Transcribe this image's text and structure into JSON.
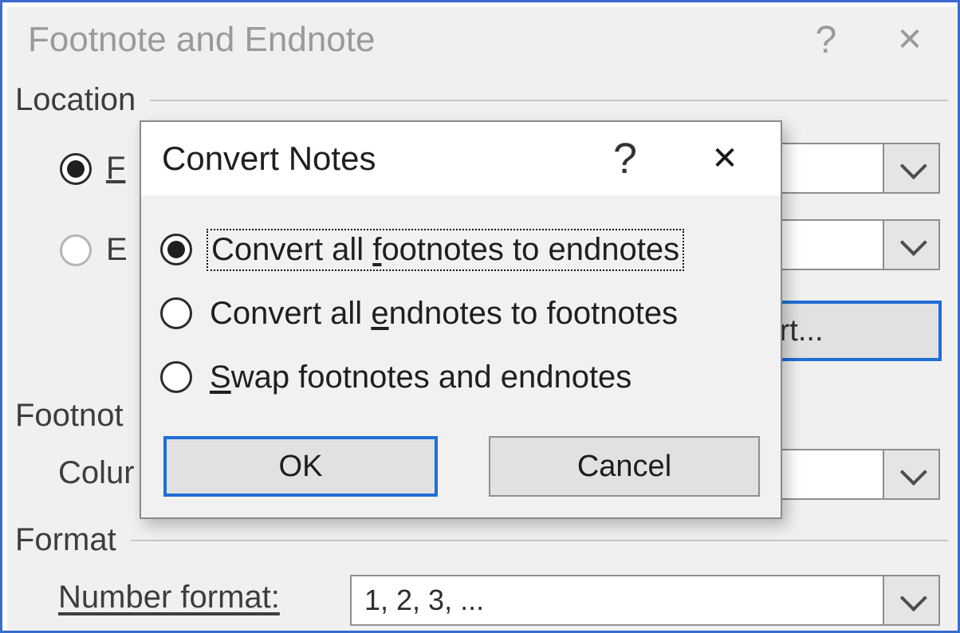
{
  "parent": {
    "title": "Footnote and Endnote",
    "sections": {
      "location": "Location",
      "layout": "Footnot",
      "format": "Format"
    },
    "radio": {
      "footnotes_label_visible": "F",
      "endnotes_label_visible": "E"
    },
    "labels": {
      "columns_visible": "Colur",
      "number_format": "Number format:"
    },
    "convert_button_visible": "vert...",
    "number_format_value": "1, 2, 3, ..."
  },
  "child": {
    "title": "Convert Notes",
    "options": {
      "fn_to_en_pre": "Convert all ",
      "fn_to_en_u": "f",
      "fn_to_en_post": "ootnotes to endnotes",
      "en_to_fn_pre": "Convert all ",
      "en_to_fn_u": "e",
      "en_to_fn_post": "ndnotes to footnotes",
      "swap_u": "S",
      "swap_post": "wap footnotes and endnotes"
    },
    "buttons": {
      "ok": "OK",
      "cancel": "Cancel"
    }
  },
  "glyphs": {
    "help": "?",
    "close": "✕"
  }
}
